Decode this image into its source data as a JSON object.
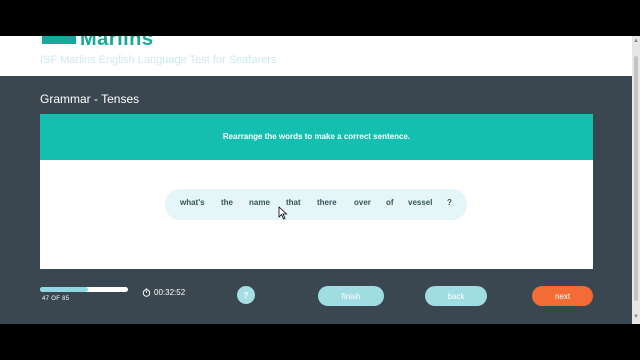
{
  "header": {
    "logo_text": "Marlins",
    "subtitle": "ISF Marlins English Language Test for Seafarers"
  },
  "section": {
    "title": "Grammar - Tenses"
  },
  "question": {
    "instruction": "Rearrange the words to make a correct sentence.",
    "words": [
      "what's",
      "the",
      "name",
      "that",
      "there",
      "over",
      "of",
      "vessel",
      "?"
    ]
  },
  "footer": {
    "progress_label": "47 OF 85",
    "progress_fraction": 0.55,
    "timer": "00:32:52",
    "help_label": "?",
    "finish_label": "finish",
    "back_label": "back",
    "next_label": "next"
  },
  "colors": {
    "accent": "#15bfb0",
    "next_button": "#f36c35",
    "background": "#3b4750"
  }
}
